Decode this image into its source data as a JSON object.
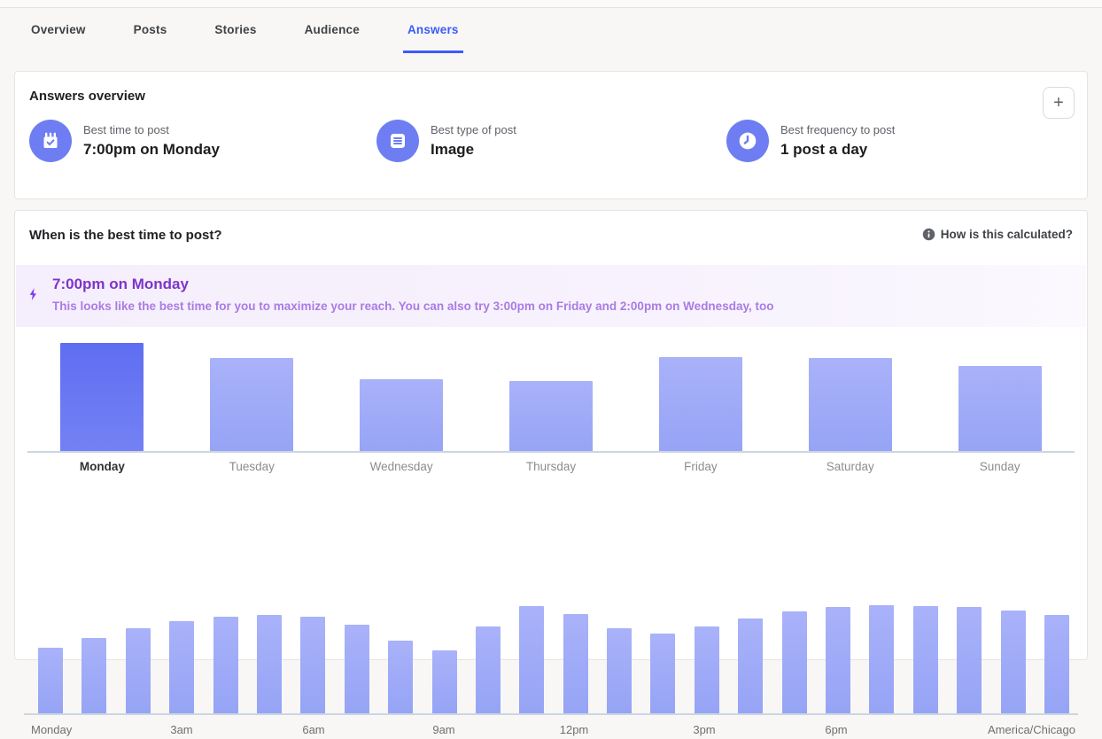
{
  "tabs": [
    {
      "label": "Overview",
      "active": false
    },
    {
      "label": "Posts",
      "active": false
    },
    {
      "label": "Stories",
      "active": false
    },
    {
      "label": "Audience",
      "active": false
    },
    {
      "label": "Answers",
      "active": true
    }
  ],
  "overview_card": {
    "title": "Answers overview",
    "add_button": "+",
    "metrics": [
      {
        "icon": "calendar-check-icon",
        "label": "Best time to post",
        "value": "7:00pm on Monday"
      },
      {
        "icon": "post-document-icon",
        "label": "Best type of post",
        "value": "Image"
      },
      {
        "icon": "clock-icon",
        "label": "Best frequency to post",
        "value": "1 post a day"
      }
    ]
  },
  "best_time_card": {
    "title": "When is the best time to post?",
    "help_label": "How is this calculated?",
    "highlight": {
      "title": "7:00pm on Monday",
      "description": "This looks like the best time for you to maximize your reach. You can also try 3:00pm on Friday and 2:00pm on Wednesday, too"
    }
  },
  "chart_data": [
    {
      "type": "bar",
      "title": "Best day of week to post (relative engagement, % of max)",
      "categories": [
        "Monday",
        "Tuesday",
        "Wednesday",
        "Thursday",
        "Friday",
        "Saturday",
        "Sunday"
      ],
      "values": [
        100,
        86,
        66,
        65,
        87,
        86,
        79
      ],
      "highlight_category": "Monday",
      "ylim": [
        0,
        100
      ],
      "grid": false,
      "legend": false
    },
    {
      "type": "bar",
      "title": "Best hour of day to post (24 hourly bars, relative engagement, % of max)",
      "x_tick_labels": [
        "Monday",
        "3am",
        "6am",
        "9am",
        "12pm",
        "3pm",
        "6pm",
        "America/Chicago"
      ],
      "values": [
        61,
        70,
        79,
        85,
        89,
        91,
        89,
        82,
        67,
        58,
        80,
        99,
        92,
        79,
        74,
        80,
        88,
        94,
        98,
        100,
        99,
        98,
        95,
        91
      ],
      "peak_hour_index": 19,
      "timezone": "America/Chicago",
      "ylim": [
        0,
        100
      ],
      "grid": false,
      "legend": false
    }
  ],
  "colors": {
    "accent_blue": "#3b5bfc",
    "icon_circle": "#6e7ef2",
    "bar_highlight_top": "#5f6ef1",
    "bar_highlight_bottom": "#7481f4",
    "bar_light_top": "#a9b2f9",
    "bar_light_bottom": "#96a4f6",
    "callout_bg": "#f5eefc",
    "callout_title": "#7c35c9",
    "callout_text": "#a97ce4",
    "axis_line": "#ccd5e2"
  }
}
